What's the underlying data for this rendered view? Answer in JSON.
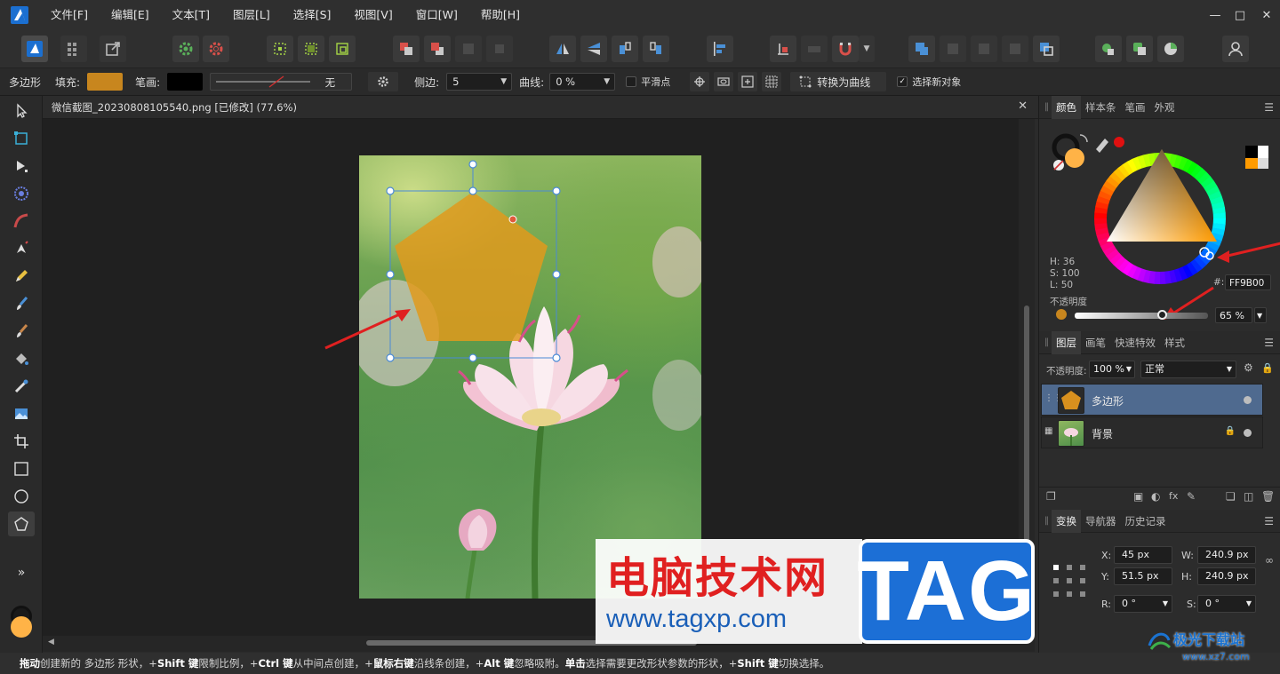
{
  "menubar": {
    "items": [
      "文件[F]",
      "编辑[E]",
      "文本[T]",
      "图层[L]",
      "选择[S]",
      "视图[V]",
      "窗口[W]",
      "帮助[H]"
    ]
  },
  "context_bar": {
    "tool_name": "多边形",
    "fill_label": "填充:",
    "fill_color": "#c8861e",
    "stroke_label": "笔画:",
    "stroke_color": "#000000",
    "stroke_style_value": "无",
    "sides_label": "侧边:",
    "sides_value": "5",
    "curve_label": "曲线:",
    "curve_value": "0 %",
    "smooth_points_label": "平滑点",
    "convert_to_curves_label": "转换为曲线",
    "select_new_object_label": "选择新对象"
  },
  "document": {
    "tab_title": "微信截图_20230808105540.png [已修改] (77.6%)"
  },
  "color_panel": {
    "tabs": [
      "颜色",
      "样本条",
      "笔画",
      "外观"
    ],
    "h_label": "H: 36",
    "s_label": "S: 100",
    "l_label": "L: 50",
    "hex_prefix": "#:",
    "hex_value": "FF9B00",
    "opacity_label": "不透明度",
    "opacity_value": "65 %",
    "current_color": "#ffb347"
  },
  "layers_panel": {
    "tabs": [
      "图层",
      "画笔",
      "快速特效",
      "样式"
    ],
    "opacity_label": "不透明度:",
    "opacity_value": "100 %",
    "blend_mode": "正常",
    "layers": [
      {
        "name": "多边形",
        "selected": true
      },
      {
        "name": "背景",
        "selected": false,
        "locked": true
      }
    ]
  },
  "transform_panel": {
    "tabs": [
      "变换",
      "导航器",
      "历史记录"
    ],
    "x_label": "X:",
    "x_value": "45 px",
    "y_label": "Y:",
    "y_value": "51.5 px",
    "w_label": "W:",
    "w_value": "240.9 px",
    "h_label": "H:",
    "h_value": "240.9 px",
    "r_label": "R:",
    "r_value": "0 °",
    "s_label": "S:",
    "s_value": "0 °"
  },
  "statusbar": {
    "parts": [
      {
        "b": "拖动",
        "t": " 创建新的 多边形 形状，+"
      },
      {
        "b": "Shift 键",
        "t": " 限制比例，+"
      },
      {
        "b": "Ctrl 键",
        "t": " 从中间点创建，+"
      },
      {
        "b": "鼠标右键",
        "t": " 沿线条创建，+"
      },
      {
        "b": "Alt 键",
        "t": " 忽略吸附。"
      },
      {
        "b": "单击",
        "t": " 选择需要更改形状参数的形状，+"
      },
      {
        "b": "Shift 键",
        "t": " 切换选择。"
      }
    ]
  },
  "watermarks": {
    "site_cn": "电脑技术网",
    "site_url": "www.tagxp.com",
    "tag": "TAG",
    "corner_cn": "极光下载站",
    "corner_url": "www.xz7.com"
  },
  "colors": {
    "accent_blue": "#1e6bd6",
    "polygon_fill": "#e09a1c",
    "arrow_red": "#e02020"
  }
}
